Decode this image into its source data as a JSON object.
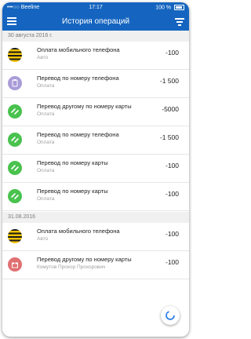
{
  "statusbar": {
    "carrier": "•••○○ Beeline",
    "time": "17:17",
    "battery": "100 %"
  },
  "appbar": {
    "title": "История операций"
  },
  "sections": [
    {
      "date": "30 августа 2016 г."
    },
    {
      "date": "31.08.2016"
    }
  ],
  "rows": [
    {
      "title": "Оплата мобильного телефона",
      "sub": "Авто",
      "amount": "-100",
      "icon": "beeline-icon"
    },
    {
      "title": "Перевод по номеру телефона",
      "sub": "Оплата",
      "amount": "-1 500",
      "icon": "clipboard-icon"
    },
    {
      "title": "Перевод другому по номеру карты",
      "sub": "Оплата",
      "amount": "-5000",
      "icon": "transfer-icon"
    },
    {
      "title": "Перевод по номеру телефона",
      "sub": "Оплата",
      "amount": "-1 500",
      "icon": "transfer-icon"
    },
    {
      "title": "Перевод по номеру карты",
      "sub": "Оплата",
      "amount": "-100",
      "icon": "transfer-icon"
    },
    {
      "title": "Перевод по номеру карты",
      "sub": "Оплата",
      "amount": "-100",
      "icon": "transfer-icon"
    },
    {
      "title": "Оплата мобильного телефона",
      "sub": "Авто",
      "amount": "-100",
      "icon": "beeline-icon"
    },
    {
      "title": "Перевод другому по номеру карты",
      "sub": "Комутов Прохор Прохорович",
      "amount": "-100",
      "icon": "gift-icon"
    }
  ],
  "colors": {
    "accent": "#1565c0",
    "green": "#49c24e",
    "purple": "#a99cd9",
    "red": "#e07072",
    "fab_ring": "#2f80ed"
  }
}
